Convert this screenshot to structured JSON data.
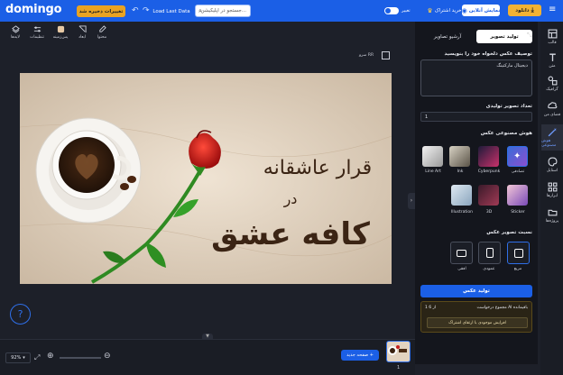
{
  "topbar": {
    "logo": "domingo",
    "saved_badge": "تغییرات ذخیره شد",
    "load_last": "Load Last Data",
    "search_placeholder": "جستجو در اپلیکیشن...",
    "toggle_label": "تغییر",
    "subscribe": "خرید اشتراک",
    "online_show": "نمایش آنلاین",
    "download": "دانلود",
    "brand_color": "#1b5fe6"
  },
  "toolbar": {
    "items": [
      "محتوا",
      "ابعاد",
      "پس‌زمینه",
      "تنظیمات",
      "لایه‌ها"
    ],
    "frame_label": "سرو RR"
  },
  "canvas": {
    "headline_1": "قرار عاشقانه",
    "headline_2": "در",
    "headline_3": "کافه عشق"
  },
  "bottom": {
    "zoom": "92%",
    "new_page": "صفحه جدید +",
    "page_num": "1"
  },
  "panel": {
    "tab_generate": "تولید تصویر",
    "tab_archive": "آرشیو تصاویر",
    "describe_label": "توصیف عکس دلخواه خود را بنویسید",
    "prompt_value": "دیجیتال مارکتینگ",
    "count_label": "تعداد تصویر تولیدی",
    "count_value": "1",
    "style_label": "هوش مصنوعی عکس",
    "styles_row1": [
      "تصادفی",
      "Cyberpunk",
      "Ink",
      "Line Art"
    ],
    "styles_row2": [
      "Sticker",
      "3D",
      "Illustration"
    ],
    "ratio_label": "نسبت تصویر عکس",
    "ratios": [
      "مربع",
      "عمودی",
      "افقی"
    ],
    "generate_button": "تولید عکس",
    "credits_label": "مجموع درخواست AI باقیمانده",
    "credits_value": "1 از 6",
    "upgrade_button": "افزایش موجودی با ارتقای اشتراک"
  },
  "sidebar": {
    "items": [
      "قالب",
      "متن",
      "گرافیک",
      "فضای من",
      "هوش مصنوعی",
      "استایل",
      "ابزارها",
      "پروژه‌ها"
    ]
  }
}
